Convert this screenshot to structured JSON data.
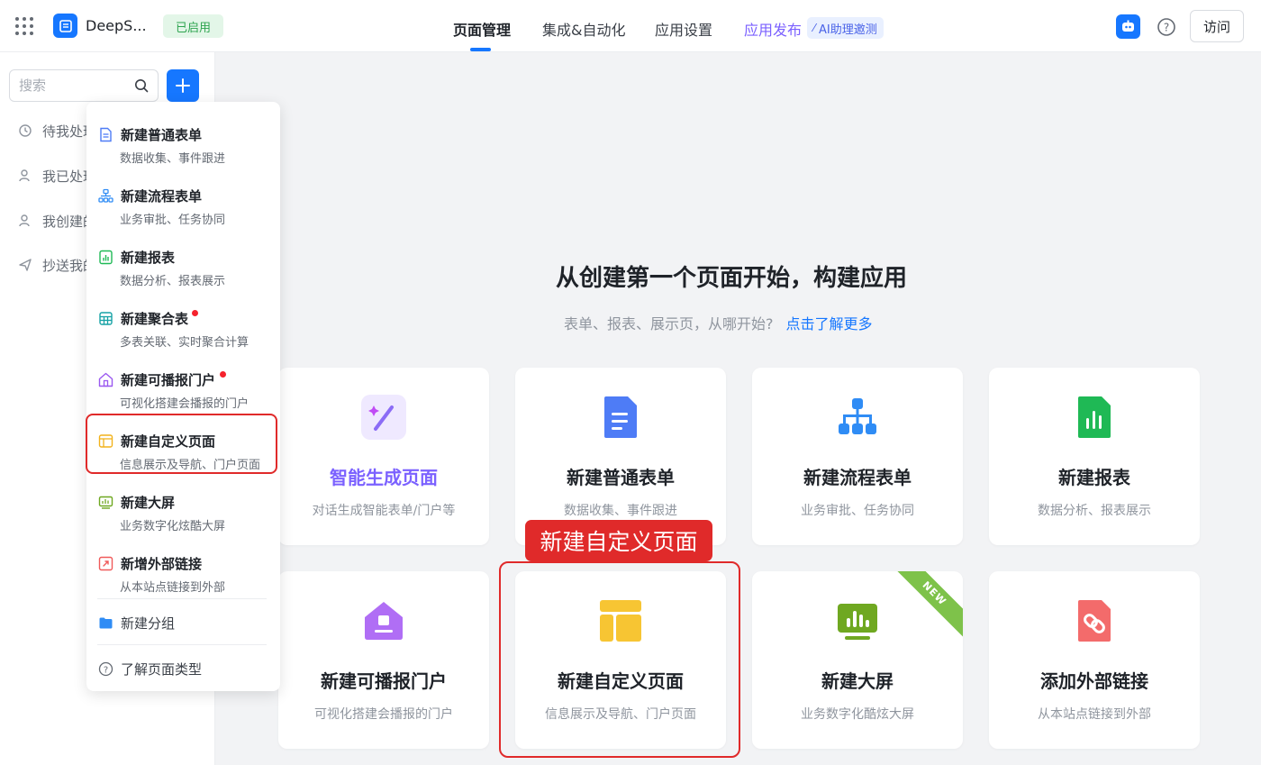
{
  "header": {
    "app_name": "DeepS...",
    "status": "已启用",
    "tabs": [
      {
        "label": "页面管理"
      },
      {
        "label": "集成&自动化"
      },
      {
        "label": "应用设置"
      },
      {
        "label": "应用发布"
      }
    ],
    "ai_chip": "AI助理邀测",
    "visit_label": "访问"
  },
  "sidebar": {
    "search_placeholder": "搜索",
    "items": [
      {
        "label": "待我处理",
        "icon": "clock-icon"
      },
      {
        "label": "我已处理",
        "icon": "user-check-icon"
      },
      {
        "label": "我创建的",
        "icon": "user-plus-icon"
      },
      {
        "label": "抄送我的",
        "icon": "send-icon"
      }
    ]
  },
  "dropdown": {
    "items": [
      {
        "title": "新建普通表单",
        "sub": "数据收集、事件跟进",
        "icon": "form-icon"
      },
      {
        "title": "新建流程表单",
        "sub": "业务审批、任务协同",
        "icon": "flow-icon"
      },
      {
        "title": "新建报表",
        "sub": "数据分析、报表展示",
        "icon": "report-icon"
      },
      {
        "title": "新建聚合表",
        "sub": "多表关联、实时聚合计算",
        "icon": "aggregate-icon"
      },
      {
        "title": "新建可播报门户",
        "sub": "可视化搭建会播报的门户",
        "icon": "portal-icon"
      },
      {
        "title": "新建自定义页面",
        "sub": "信息展示及导航、门户页面",
        "icon": "custom-page-icon"
      },
      {
        "title": "新建大屏",
        "sub": "业务数字化炫酷大屏",
        "icon": "dashboard-icon"
      },
      {
        "title": "新增外部链接",
        "sub": "从本站点链接到外部",
        "icon": "external-link-icon"
      }
    ],
    "group_label": "新建分组",
    "learn_label": "了解页面类型"
  },
  "main": {
    "title": "从创建第一个页面开始，构建应用",
    "subtitle": "表单、报表、展示页，从哪开始?",
    "learn_more": "点击了解更多",
    "cards": [
      {
        "title": "智能生成页面",
        "sub": "对话生成智能表单/门户等",
        "icon": "ai-wand-icon"
      },
      {
        "title": "新建普通表单",
        "sub": "数据收集、事件跟进",
        "icon": "form-icon"
      },
      {
        "title": "新建流程表单",
        "sub": "业务审批、任务协同",
        "icon": "flow-icon"
      },
      {
        "title": "新建报表",
        "sub": "数据分析、报表展示",
        "icon": "report-icon"
      },
      {
        "title": "新建可播报门户",
        "sub": "可视化搭建会播报的门户",
        "icon": "portal-icon"
      },
      {
        "title": "新建自定义页面",
        "sub": "信息展示及导航、门户页面",
        "icon": "custom-page-icon"
      },
      {
        "title": "新建大屏",
        "sub": "业务数字化酷炫大屏",
        "icon": "dashboard-icon"
      },
      {
        "title": "添加外部链接",
        "sub": "从本站点链接到外部",
        "icon": "external-link-icon"
      }
    ],
    "ribbon_text": "NEW",
    "callout": "新建自定义页面"
  },
  "colors": {
    "accent": "#1677ff",
    "highlight": "#e02a2a",
    "ai_purple": "#7b61ff"
  }
}
